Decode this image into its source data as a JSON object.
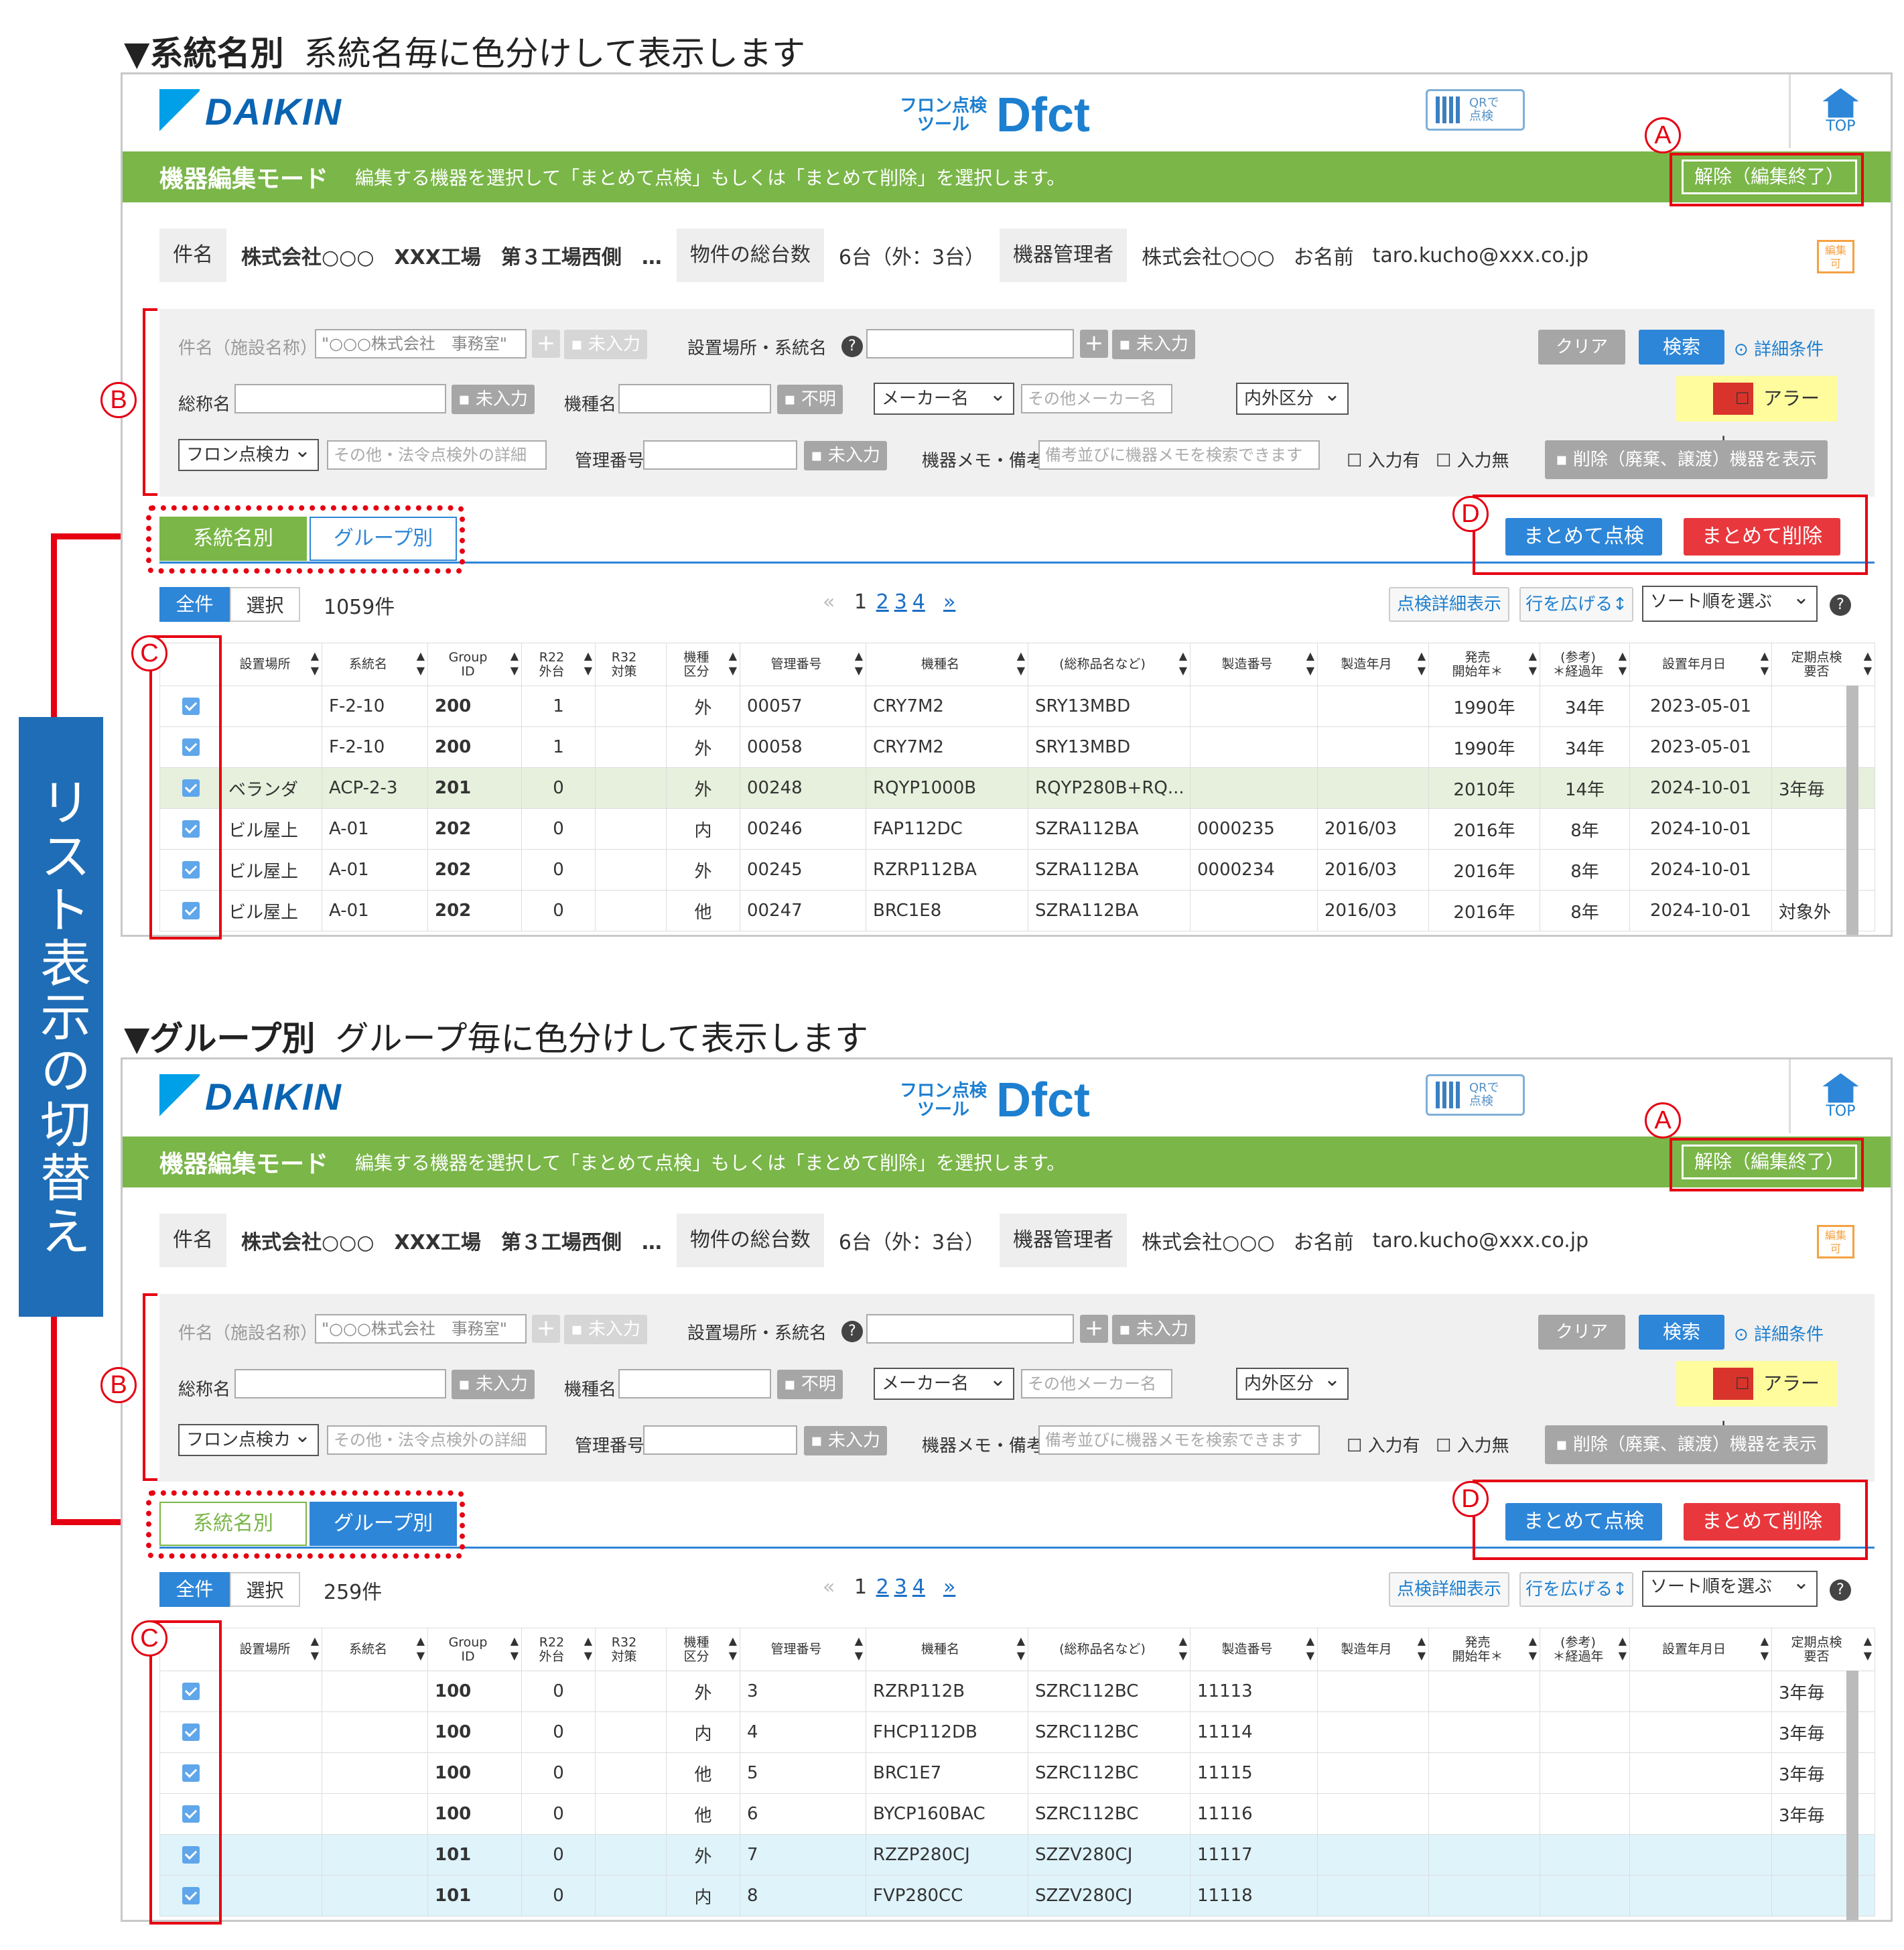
{
  "side_label": "リスト表示の切替え",
  "annotations": {
    "a": "A",
    "b": "B",
    "c": "C",
    "d": "D"
  },
  "sections": [
    {
      "caption_title": "▼系統名別",
      "caption_desc": "系統名毎に色分けして表示します",
      "count": "1059件",
      "rows": [
        [
          "",
          "F-2-10",
          "200",
          "1",
          "",
          "外",
          "00057",
          "CRY7M2",
          "SRY13MBD",
          "",
          "",
          "1990年",
          "34年",
          "2023-05-01",
          ""
        ],
        [
          "",
          "F-2-10",
          "200",
          "1",
          "",
          "外",
          "00058",
          "CRY7M2",
          "SRY13MBD",
          "",
          "",
          "1990年",
          "34年",
          "2023-05-01",
          ""
        ],
        [
          "ベランダ",
          "ACP-2-3",
          "201",
          "0",
          "",
          "外",
          "00248",
          "RQYP1000B",
          "RQYP280B+RQ...",
          "",
          "",
          "2010年",
          "14年",
          "2024-10-01",
          "3年毎"
        ],
        [
          "ビル屋上",
          "A-01",
          "202",
          "0",
          "",
          "内",
          "00246",
          "FAP112DC",
          "SZRA112BA",
          "0000235",
          "2016/03",
          "2016年",
          "8年",
          "2024-10-01",
          ""
        ],
        [
          "ビル屋上",
          "A-01",
          "202",
          "0",
          "",
          "外",
          "00245",
          "RZRP112BA",
          "SZRA112BA",
          "0000234",
          "2016/03",
          "2016年",
          "8年",
          "2024-10-01",
          ""
        ],
        [
          "ビル屋上",
          "A-01",
          "202",
          "0",
          "",
          "他",
          "00247",
          "BRC1E8",
          "SZRA112BA",
          "",
          "2016/03",
          "2016年",
          "8年",
          "2024-10-01",
          "対象外"
        ]
      ]
    },
    {
      "caption_title": "▼グループ別",
      "caption_desc": "グループ毎に色分けして表示します",
      "count": "259件",
      "rows": [
        [
          "",
          "",
          "100",
          "0",
          "",
          "外",
          "3",
          "RZRP112B",
          "SZRC112BC",
          "11113",
          "",
          "",
          "",
          "",
          "3年毎"
        ],
        [
          "",
          "",
          "100",
          "0",
          "",
          "内",
          "4",
          "FHCP112DB",
          "SZRC112BC",
          "11114",
          "",
          "",
          "",
          "",
          "3年毎"
        ],
        [
          "",
          "",
          "100",
          "0",
          "",
          "他",
          "5",
          "BRC1E7",
          "SZRC112BC",
          "11115",
          "",
          "",
          "",
          "",
          "3年毎"
        ],
        [
          "",
          "",
          "100",
          "0",
          "",
          "他",
          "6",
          "BYCP160BAC",
          "SZRC112BC",
          "11116",
          "",
          "",
          "",
          "",
          "3年毎"
        ],
        [
          "",
          "",
          "101",
          "0",
          "",
          "外",
          "7",
          "RZZP280CJ",
          "SZZV280CJ",
          "11117",
          "",
          "",
          "",
          "",
          ""
        ],
        [
          "",
          "",
          "101",
          "0",
          "",
          "内",
          "8",
          "FVP280CC",
          "SZZV280CJ",
          "11118",
          "",
          "",
          "",
          "",
          ""
        ]
      ]
    }
  ],
  "app": {
    "logo": "DAIKIN",
    "tool_small": "フロン点検\nツール",
    "tool_name": "Dfct",
    "qr_label": "QRで\n点検",
    "top_label": "TOP",
    "mode_title": "機器編集モード",
    "mode_desc": "編集する機器を選択して「まとめて点検」もしくは「まとめて削除」を選択します。",
    "release_button": "解除（編集終了）",
    "edit_badge": "編集\n可"
  },
  "info": {
    "subject_label": "件名",
    "subject_value": "株式会社○○○　XXX工場　第３工場西側　…",
    "total_label": "物件の総台数",
    "total_value": "6台（外：3台）",
    "manager_label": "機器管理者",
    "manager_company": "株式会社○○○",
    "manager_name": "お名前",
    "manager_email": "taro.kucho@xxx.co.jp"
  },
  "search": {
    "facility_label": "件名（施設名称）",
    "facility_value": "\"○○○株式会社　事務室\"",
    "unentered": "未入力",
    "location_label": "設置場所・系統名",
    "clear": "クリア",
    "search": "検索",
    "detail": "詳細条件",
    "generic_label": "総称名",
    "model_label": "機種名",
    "unknown": "不明",
    "maker_select": "メーカー名",
    "other_maker": "その他メーカー名",
    "inout_select": "内外区分",
    "alert": "アラート",
    "freon_select": "フロン点検カ",
    "other_law": "その他・法令点検外の詳細",
    "mgmt_label": "管理番号",
    "memo_label": "機器メモ・備考",
    "memo_placeholder": "備考並びに機器メモを検索できます",
    "has_input": "入力有",
    "no_input": "入力無",
    "deleted_toggle": "削除（廃棄、譲渡）機器を表示"
  },
  "tabs": {
    "system": "系統名別",
    "group": "グループ別"
  },
  "actions": {
    "bulk_check": "まとめて点検",
    "bulk_delete": "まとめて削除"
  },
  "list": {
    "all": "全件",
    "select": "選択",
    "pager_prev": "«",
    "pages": [
      "1",
      "2",
      "3",
      "4"
    ],
    "pager_next": "»",
    "detail_view": "点検詳細表示",
    "expand_rows": "行を広げる↕",
    "sort_select": "ソート順を選ぶ",
    "headers": [
      "設置場所",
      "系統名",
      "Group\nID",
      "R22\n外台",
      "R32\n対策",
      "機種\n区分",
      "管理番号",
      "機種名",
      "(総称品名など)",
      "製造番号",
      "製造年月",
      "発売\n開始年＊",
      "(参考)\n＊経過年",
      "設置年月日",
      "定期点検\n要否"
    ]
  },
  "colors": {
    "green": "#7ab648",
    "blue": "#2d86d8",
    "red": "#e8383d",
    "row_green": "#e6f0dc",
    "row_blue": "#dff3fb"
  }
}
